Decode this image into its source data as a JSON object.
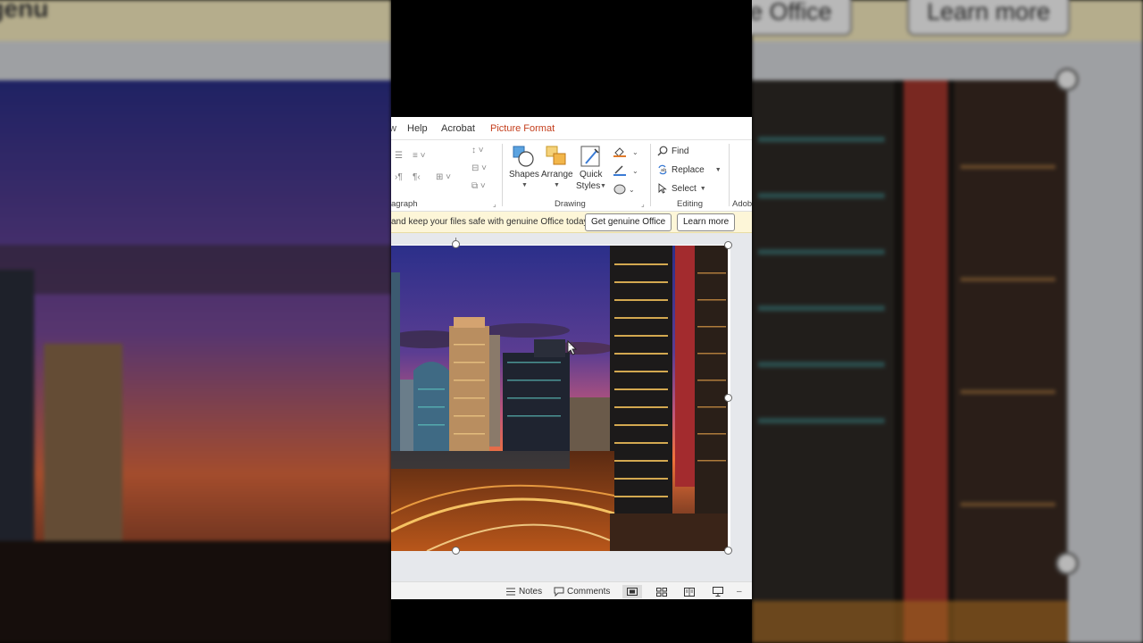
{
  "ribbon_tabs": [
    {
      "label": "Help"
    },
    {
      "label": "Acrobat"
    },
    {
      "label": "Picture Format",
      "active": true
    }
  ],
  "ribbon": {
    "paragraph_group_label": "agraph",
    "drawing_group_label": "Drawing",
    "editing_group_label": "Editing",
    "adobe_group_label": "Adob",
    "shapes_label": "Shapes",
    "arrange_label": "Arrange",
    "quick_styles_label_1": "Quick",
    "quick_styles_label_2": "Styles",
    "find_label": "Find",
    "replace_label": "Replace",
    "select_label": "Select"
  },
  "notice": {
    "text": "and keep your files safe with genuine Office today.",
    "get_genuine_label": "Get genuine Office",
    "learn_more_label": "Learn more"
  },
  "background_banner": {
    "text": "nd keep your files safe with genu",
    "right_button_partial": "ne Office",
    "learn_more_label": "Learn more"
  },
  "statusbar": {
    "notes_label": "Notes",
    "comments_label": "Comments",
    "zoom_minus": "–"
  },
  "colors": {
    "accent_tab": "#c43e1c",
    "notice_bg": "#fdf6d8",
    "sky_top": "#2b2f8a",
    "sky_bottom": "#f0733a"
  },
  "icons": {
    "shapes": "shapes-icon",
    "arrange": "arrange-icon",
    "quick_styles": "quick-styles-icon",
    "fill": "fill-icon",
    "find": "search-icon",
    "replace": "replace-icon",
    "select": "cursor-icon"
  }
}
